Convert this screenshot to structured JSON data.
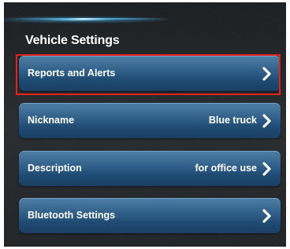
{
  "screen": {
    "title": "Vehicle Settings"
  },
  "menu": {
    "items": [
      {
        "label": "Reports and Alerts",
        "value": ""
      },
      {
        "label": "Nickname",
        "value": "Blue truck"
      },
      {
        "label": "Description",
        "value": "for office use"
      },
      {
        "label": "Bluetooth Settings",
        "value": ""
      }
    ]
  },
  "icons": {
    "row_arrow": "chevron-right-icon"
  },
  "colors": {
    "row_blue": "#2f5f88",
    "highlight_red": "#e2231a",
    "background": "#23262a"
  }
}
